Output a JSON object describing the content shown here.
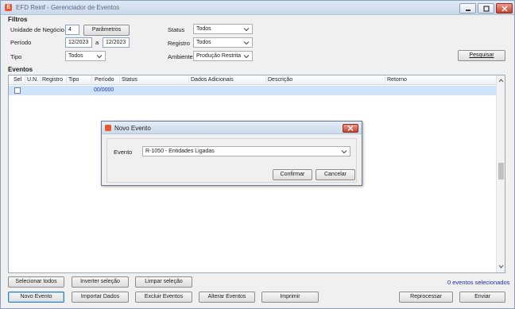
{
  "window": {
    "title": "EFD Reinf - Gerenciador de Eventos"
  },
  "filters": {
    "section_label": "Filtros",
    "unidade_label": "Unidade de Negócio",
    "unidade_value": "4",
    "parametros_button": "Parâmetros",
    "periodo_label": "Período",
    "periodo_from": "12/2023",
    "periodo_sep": "a",
    "periodo_to": "12/2023",
    "tipo_label": "Tipo",
    "tipo_value": "Todos",
    "status_label": "Status",
    "status_value": "Todos",
    "registro_label": "Registro",
    "registro_value": "Todos",
    "ambiente_label": "Ambiente",
    "ambiente_value": "Produção Restrita",
    "pesquisar_button": "Pesquisar"
  },
  "events": {
    "section_label": "Eventos",
    "columns": [
      "Sel",
      "U.N.",
      "Registro",
      "Tipo",
      "Período",
      "Status",
      "Dados Adicionais",
      "Descrição",
      "Retorno"
    ],
    "rows": [
      {
        "period": "00/0000"
      }
    ]
  },
  "footer": {
    "selecionar_todos": "Selecionar todos",
    "inverter_selecao": "Inverter seleção",
    "limpar_selecao": "Limpar seleção",
    "selected_count": "0 eventos selecionados",
    "novo_evento": "Novo Evento",
    "importar_dados": "Importar Dados",
    "excluir_eventos": "Excluir Eventos",
    "alterar_eventos": "Alterar Eventos",
    "imprimir": "Imprimir",
    "reprocessar": "Reprocessar",
    "enviar": "Enviar"
  },
  "dialog": {
    "title": "Novo Evento",
    "evento_label": "Evento",
    "evento_value": "R-1050 - Entidades Ligadas",
    "confirmar": "Confirmar",
    "cancelar": "Cancelar"
  },
  "colors": {
    "accent_selection": "#cfe3fa",
    "link_blue": "#1f2ea8",
    "app_icon": "#e8562a"
  }
}
